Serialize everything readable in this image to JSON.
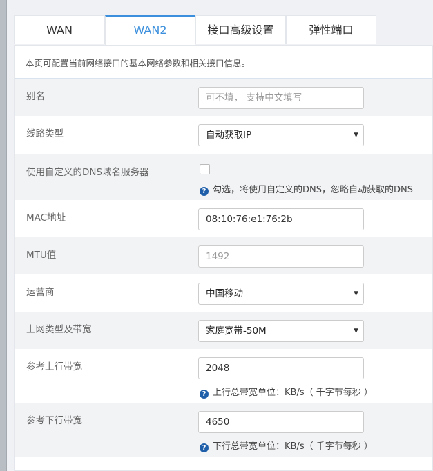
{
  "tabs": [
    {
      "label": "WAN"
    },
    {
      "label": "WAN2"
    },
    {
      "label": "接口高级设置"
    },
    {
      "label": "弹性端口"
    }
  ],
  "active_tab": "WAN2",
  "description": "本页可配置当前网络接口的基本网络参数和相关接口信息。",
  "form": {
    "alias": {
      "label": "别名",
      "placeholder": "可不填， 支持中文填写"
    },
    "line_type": {
      "label": "线路类型",
      "value": "自动获取IP"
    },
    "custom_dns": {
      "label": "使用自定义的DNS域名服务器",
      "checked": false,
      "hint": "勾选，将使用自定义的DNS，忽略自动获取的DNS"
    },
    "mac": {
      "label": "MAC地址",
      "value": "08:10:76:e1:76:2b"
    },
    "mtu": {
      "label": "MTU值",
      "value": "1492"
    },
    "isp": {
      "label": "运营商",
      "value": "中国移动"
    },
    "net_type": {
      "label": "上网类型及带宽",
      "value": "家庭宽带-50M"
    },
    "upload": {
      "label": "参考上行带宽",
      "value": "2048",
      "hint": "上行总带宽单位：KB/s（ 千字节每秒 ）"
    },
    "download": {
      "label": "参考下行带宽",
      "value": "4650",
      "hint": "下行总带宽单位：KB/s（ 千字节每秒 ）"
    }
  },
  "icons": {
    "help": "question-circle-icon",
    "dropdown": "caret-down-icon"
  },
  "colors": {
    "accent": "#3b8fdc",
    "help_icon": "#1f5faa",
    "row_alt": "#f2f3f5"
  }
}
